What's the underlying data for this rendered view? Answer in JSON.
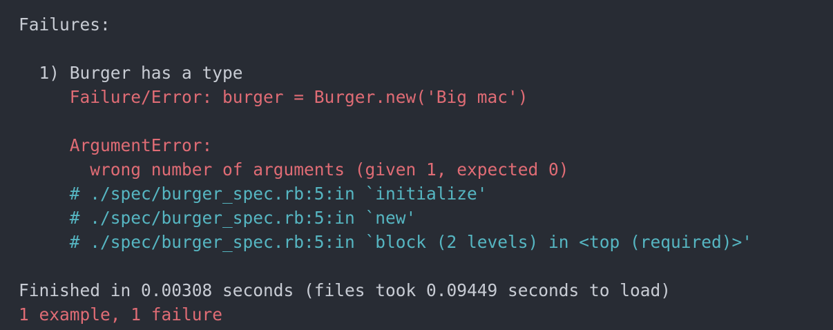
{
  "terminal": {
    "colors": {
      "background": "#282c34",
      "text": "#c8ccd4",
      "error": "#e06c75",
      "backtrace": "#56b6c2"
    },
    "failures_header": "Failures:",
    "failure": {
      "title": "  1) Burger has a type",
      "failure_error": "     Failure/Error: burger = Burger.new('Big mac')",
      "exception_class": "     ArgumentError:",
      "exception_message": "       wrong number of arguments (given 1, expected 0)",
      "backtrace": [
        "     # ./spec/burger_spec.rb:5:in `initialize'",
        "     # ./spec/burger_spec.rb:5:in `new'",
        "     # ./spec/burger_spec.rb:5:in `block (2 levels) in <top (required)>'"
      ]
    },
    "finished": "Finished in 0.00308 seconds (files took 0.09449 seconds to load)",
    "summary": "1 example, 1 failure"
  }
}
